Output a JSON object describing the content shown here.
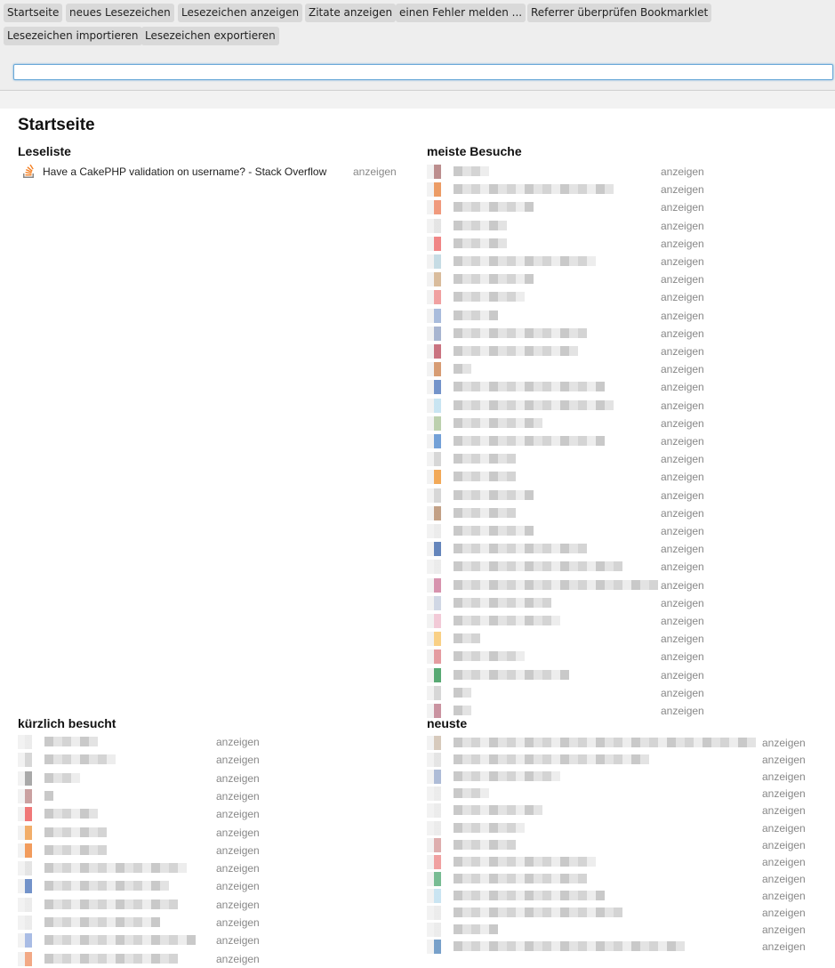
{
  "menu": {
    "home": "Startseite",
    "new_bookmark": "neues Lesezeichen",
    "show_bookmarks": "Lesezeichen anzeigen",
    "show_quotes": "Zitate anzeigen",
    "report_error": "einen Fehler melden ...",
    "check_referrer": "Referrer überprüfen",
    "bookmarklet": "Bookmarklet",
    "import_bookmarks": "Lesezeichen importieren",
    "export_bookmarks": "Lesezeichen exportieren"
  },
  "search": {
    "value": "",
    "placeholder": ""
  },
  "page": {
    "title": "Startseite"
  },
  "reading_list": {
    "heading": "Leseliste",
    "items": [
      {
        "title": "Have a CakePHP validation on username? - Stack Overflow",
        "action": "anzeigen",
        "icon": "stack-overflow-icon"
      }
    ]
  },
  "most_visited": {
    "heading": "meiste Besuche",
    "action": "anzeigen",
    "favicon_colors": [
      "#b07a7a",
      "#e98a4a",
      "#ee8866",
      "#e0e0e0",
      "#ee7070",
      "#bcd6e0",
      "#d2b08a",
      "#ee9090",
      "#9ab0d6",
      "#98a8c8",
      "#c05a6a",
      "#d08a5a",
      "#5a80c0",
      "#bfe0f0",
      "#b0c8a0",
      "#5a90d0",
      "#d0d0d0",
      "#f09a3a",
      "#d0d0d0",
      "#b89070",
      "#e8e8e8",
      "#4a70b0",
      "#e8e8e8",
      "#d080a0",
      "#c8d0e0",
      "#f0c0d0",
      "#f8c870",
      "#e08a90",
      "#3a9a5a",
      "#d0d0d0",
      "#c08090"
    ]
  },
  "recently_visited": {
    "heading": "kürzlich besucht",
    "action": "anzeigen",
    "favicon_colors": [
      "#e8e8e8",
      "#d0d0d0",
      "#9a9a9a",
      "#c09090",
      "#ee6060",
      "#f0a050",
      "#f08a40",
      "#e0e0e0",
      "#5a80c0",
      "#e8e8e8",
      "#e8e8e8",
      "#9ab0e0",
      "#f09a70"
    ]
  },
  "newest": {
    "heading": "neuste",
    "action": "anzeigen",
    "favicon_colors": [
      "#d0c0b0",
      "#e0e0e0",
      "#a0b0d0",
      "#e8e8e8",
      "#e8e8e8",
      "#e8e8e8",
      "#d8a0a0",
      "#ee9090",
      "#60b080",
      "#c0e0f0",
      "#e8e8e8",
      "#e8e8e8",
      "#6090c0"
    ]
  }
}
